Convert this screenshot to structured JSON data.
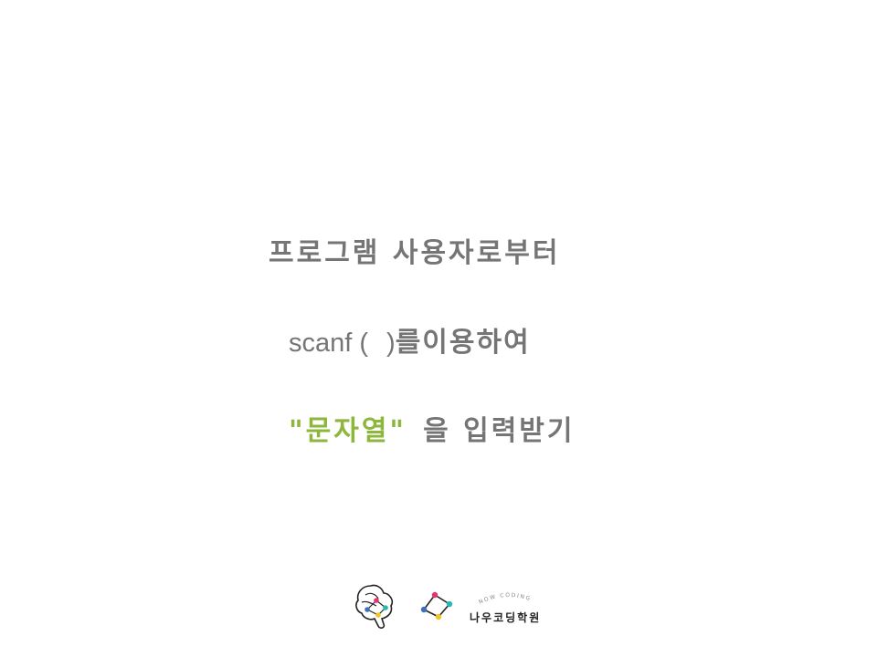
{
  "slide": {
    "line1": "프로그램 사용자로부터",
    "line2_code": "scanf (",
    "line2_close": ")",
    "line2_rest": "를이용하여",
    "line3_highlight": "\"문자열\"",
    "line3_rest": "을 입력받기"
  },
  "footer": {
    "brand_arc": "NOW CODING",
    "brand_name": "나우코딩학원"
  },
  "colors": {
    "text": "#757575",
    "highlight": "#8cb63c",
    "logo_pink": "#e8336d",
    "logo_teal": "#27b7b5",
    "logo_blue": "#3a6fc2",
    "logo_yellow": "#f3c522"
  },
  "icons": [
    "brain-logo-icon",
    "diamond-logo-icon"
  ]
}
